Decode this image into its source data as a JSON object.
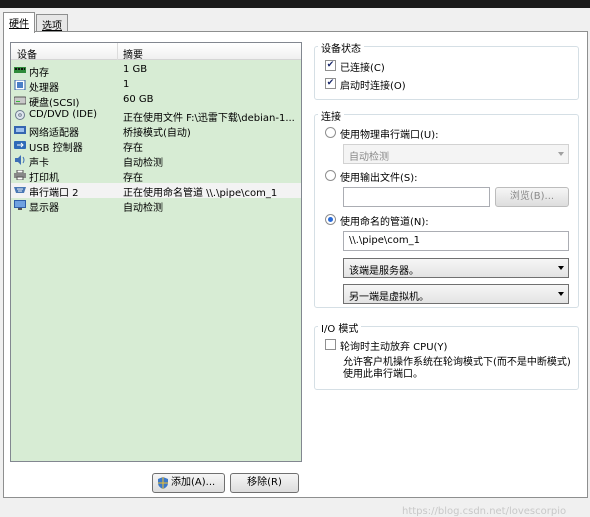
{
  "tabs": [
    {
      "label": "硬件",
      "active": true
    },
    {
      "label": "选项",
      "active": false
    }
  ],
  "device_list": {
    "header_device": "设备",
    "header_summary": "摘要",
    "rows": [
      {
        "name": "内存",
        "summary": "1 GB",
        "icon": "memory-icon"
      },
      {
        "name": "处理器",
        "summary": "1",
        "icon": "cpu-icon"
      },
      {
        "name": "硬盘(SCSI)",
        "summary": "60 GB",
        "icon": "hard-disk-icon"
      },
      {
        "name": "CD/DVD (IDE)",
        "summary": "正在使用文件 F:\\迅雷下载\\debian-1...",
        "icon": "cd-dvd-icon"
      },
      {
        "name": "网络适配器",
        "summary": "桥接模式(自动)",
        "icon": "network-adapter-icon"
      },
      {
        "name": "USB 控制器",
        "summary": "存在",
        "icon": "usb-icon"
      },
      {
        "name": "声卡",
        "summary": "自动检测",
        "icon": "sound-card-icon"
      },
      {
        "name": "打印机",
        "summary": "存在",
        "icon": "printer-icon"
      },
      {
        "name": "串行端口 2",
        "summary": "正在使用命名管道 \\\\.\\pipe\\com_1",
        "icon": "serial-port-icon",
        "selected": true
      },
      {
        "name": "显示器",
        "summary": "自动检测",
        "icon": "display-icon"
      }
    ]
  },
  "buttons": {
    "add": "添加(A)...",
    "remove": "移除(R)"
  },
  "device_status": {
    "title": "设备状态",
    "connected_label": "已连接(C)",
    "connected_checked": true,
    "connect_on_power_label": "启动时连接(O)",
    "connect_on_power_checked": true
  },
  "connection": {
    "title": "连接",
    "physical_port_label": "使用物理串行端口(U):",
    "physical_port_value": "自动检测",
    "output_file_label": "使用输出文件(S):",
    "output_file_value": "",
    "browse_label": "浏览(B)...",
    "named_pipe_label": "使用命名的管道(N):",
    "named_pipe_value": "\\\\.\\pipe\\com_1",
    "end_role": "该端是服务器。",
    "other_end": "另一端是虚拟机。",
    "selected_option": "named_pipe"
  },
  "io_mode": {
    "title": "I/O 模式",
    "yield_cpu_label": "轮询时主动放弃 CPU(Y)",
    "yield_cpu_checked": false,
    "description": "允许客户机操作系统在轮询模式下(而不是中断模式)使用此串行端口。"
  },
  "watermark": "https://blog.csdn.net/lovescorpio"
}
